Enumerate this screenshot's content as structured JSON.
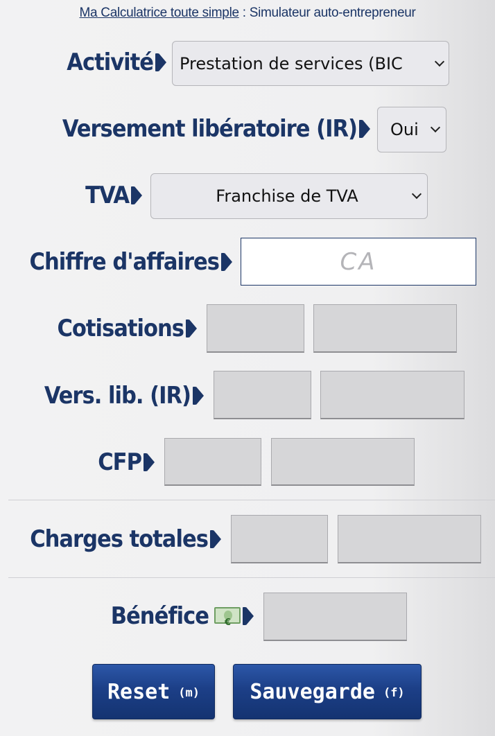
{
  "header": {
    "link_text": "Ma Calculatrice toute simple",
    "rest_text": " : Simulateur auto-entrepreneur"
  },
  "form": {
    "activite": {
      "label": "Activité",
      "selected": "Prestation de services (BIC"
    },
    "versement": {
      "label": "Versement libératoire (IR)",
      "selected": "Oui"
    },
    "tva": {
      "label": "TVA",
      "selected": "Franchise de TVA"
    },
    "ca": {
      "label": "Chiffre d'affaires",
      "placeholder": "CA",
      "value": ""
    },
    "cotisations": {
      "label": "Cotisations"
    },
    "verslib": {
      "label": "Vers. lib. (IR)"
    },
    "cfp": {
      "label": "CFP"
    },
    "charges": {
      "label": "Charges totales"
    },
    "benefice": {
      "label": "Bénéfice",
      "icon": "money-bill-icon"
    }
  },
  "buttons": {
    "reset": {
      "label": "Reset",
      "key": "(m)"
    },
    "save": {
      "label": "Sauvegarde",
      "key": "(f)"
    }
  },
  "colors": {
    "label_text": "#1b3566",
    "button_bg": "#1c3f87",
    "output_box": "#d6d6d8"
  }
}
